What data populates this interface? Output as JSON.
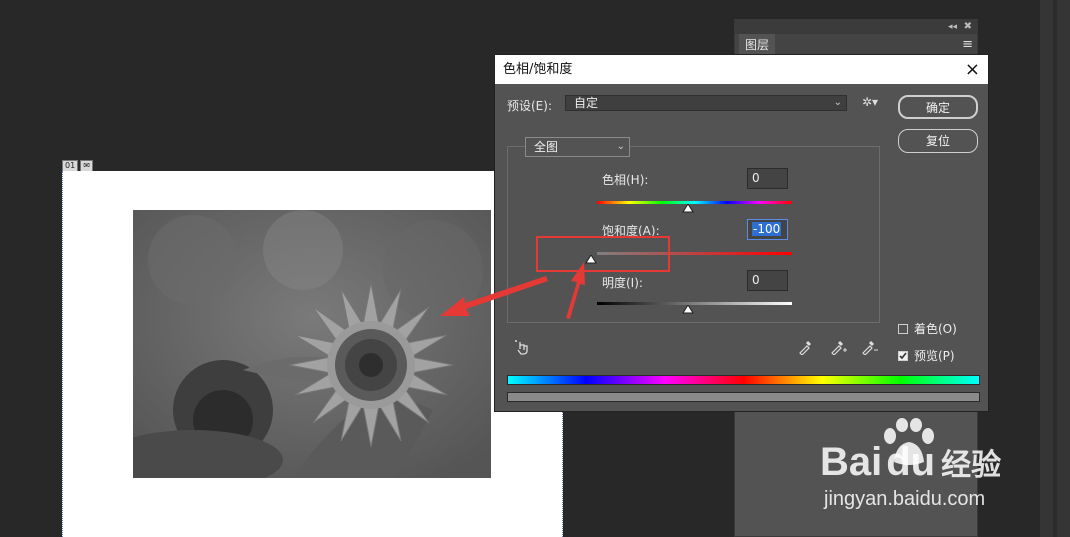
{
  "layers_panel": {
    "tab_label": "图层",
    "collapse_icon": "double-chevron-icon",
    "close_icon": "close-icon",
    "menu_icon": "panel-menu-icon"
  },
  "document": {
    "badges": [
      "01",
      "✉"
    ]
  },
  "dialog": {
    "title": "色相/饱和度",
    "close_glyph": "×",
    "preset_label": "预设(E):",
    "preset_value": "自定",
    "ok_label": "确定",
    "reset_label": "复位",
    "channel_value": "全图",
    "hue_label": "色相(H):",
    "hue_value": "0",
    "saturation_label": "饱和度(A):",
    "saturation_value": "-100",
    "lightness_label": "明度(I):",
    "lightness_value": "0",
    "sliders": {
      "hue": 0,
      "saturation": -100,
      "lightness": 0
    },
    "colorize_label": "着色(O)",
    "colorize_checked": false,
    "preview_label": "预览(P)",
    "preview_checked": true
  },
  "colors": {
    "annotation_red": "#e53935",
    "dialog_bg": "#535353",
    "canvas_bg": "#282828"
  },
  "watermark": {
    "brand": "Bai",
    "brand_suffix": "du",
    "brand_cn": "经验",
    "url": "jingyan.baidu.com"
  }
}
